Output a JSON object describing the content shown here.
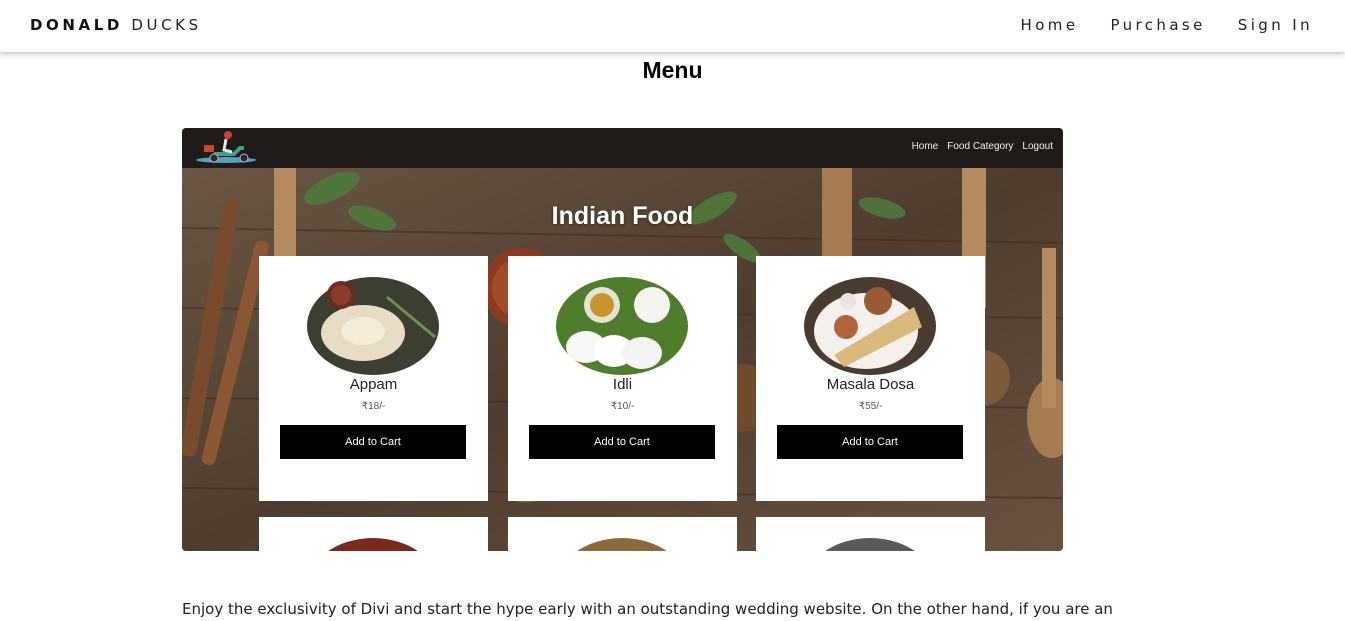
{
  "header": {
    "brand_bold": "DONALD",
    "brand_light": "DUCKS",
    "nav": [
      "Home",
      "Purchase",
      "Sign In"
    ]
  },
  "page": {
    "title": "Menu"
  },
  "embedded": {
    "nav": [
      "Home",
      "Food Category",
      "Logout"
    ],
    "hero_title": "Indian Food",
    "items": [
      {
        "name": "Appam",
        "price": "₹18/-",
        "button": "Add to Cart"
      },
      {
        "name": "Idli",
        "price": "₹10/-",
        "button": "Add to Cart"
      },
      {
        "name": "Masala Dosa",
        "price": "₹55/-",
        "button": "Add to Cart"
      }
    ]
  },
  "body": {
    "text": "Enjoy the exclusivity of Divi and start the hype early with an outstanding wedding website. On the other hand, if you are an"
  },
  "colors": {
    "button_bg": "#000000",
    "inner_nav_bg": "#1e1b19",
    "hero_wood": "#5d4937"
  }
}
